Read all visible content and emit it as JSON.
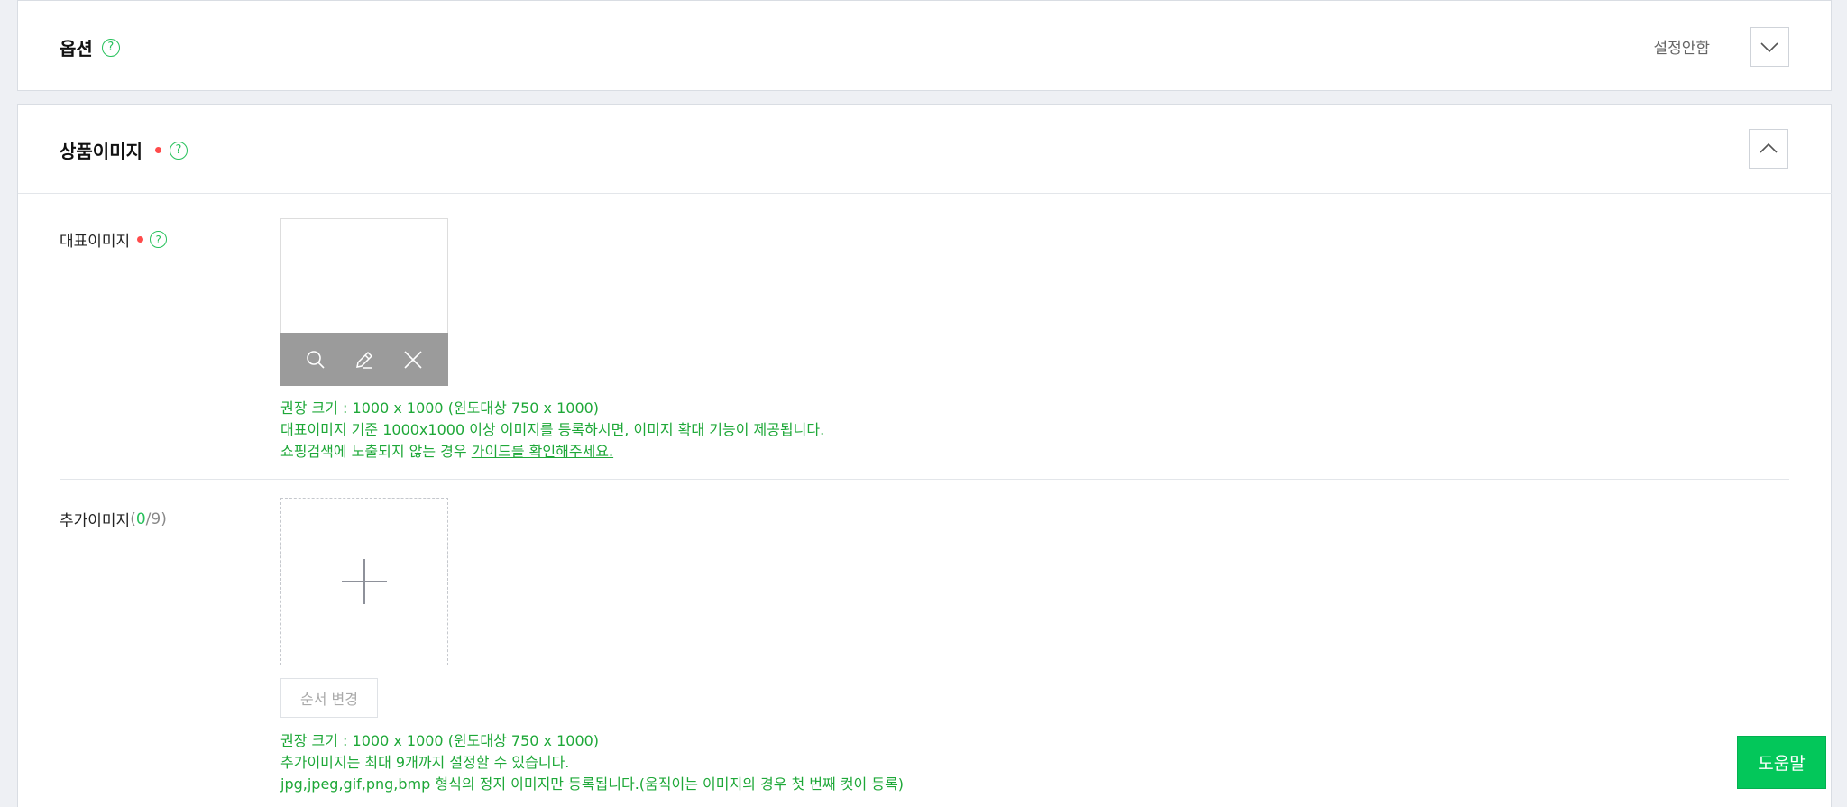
{
  "option_section": {
    "title": "옵션",
    "help_icon": "question-circle-icon",
    "status": "설정안함",
    "toggle_icon": "chevron-down-icon"
  },
  "image_section": {
    "title": "상품이미지",
    "required": true,
    "help_icon": "question-circle-icon",
    "toggle_icon": "chevron-up-icon",
    "representative": {
      "label": "대표이미지",
      "required": true,
      "tools": [
        "search-icon",
        "edit-icon",
        "close-icon"
      ],
      "guide_line1": "권장 크기 : 1000 x 1000 (윈도대상 750 x 1000)",
      "guide_line2_pre": "대표이미지 기준 1000x1000 이상 이미지를 등록하시면, ",
      "guide_line2_link": "이미지 확대 기능",
      "guide_line2_post": "이 제공됩니다.",
      "guide_line3_pre": "쇼핑검색에 노출되지 않는 경우 ",
      "guide_line3_link": "가이드를 확인해주세요."
    },
    "additional": {
      "label": "추가이미지",
      "count_open": " (",
      "count_current": "0",
      "count_total": "/9)",
      "add_icon": "plus-icon",
      "order_button": "순서 변경",
      "guide_line1": "권장 크기 : 1000 x 1000 (윈도대상 750 x 1000)",
      "guide_line2": "추가이미지는 최대 9개까지 설정할 수 있습니다.",
      "guide_line3": "jpg,jpeg,gif,png,bmp 형식의 정지 이미지만 등록됩니다.(움직이는 이미지의 경우 첫 번째 컷이 등록)"
    }
  },
  "help_button": "도움말",
  "colors": {
    "accent_green": "#27c15b",
    "guide_green": "#1ea838",
    "help_button_bg": "#03c75a",
    "required_red": "#ff4b4b",
    "page_bg": "#eef0f4"
  }
}
